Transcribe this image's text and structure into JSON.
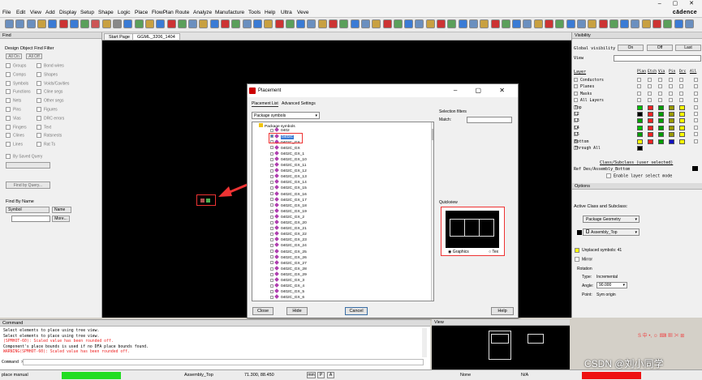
{
  "menu": [
    "File",
    "Edit",
    "View",
    "Add",
    "Display",
    "Setup",
    "Shape",
    "Logic",
    "Place",
    "FlowPlan",
    "Route",
    "Analyze",
    "Manufacture",
    "Tools",
    "Help",
    "Ultra",
    "Veve"
  ],
  "brand": "cādence",
  "find_panel": {
    "title": "Find",
    "filter_title": "Design Object Find Filter",
    "all_on": "All On",
    "all_off": "All Off",
    "col1": [
      "Groups",
      "Comps",
      "Symbols",
      "Functions",
      "Nets",
      "Pins",
      "Vias",
      "Fingers",
      "Clines",
      "Lines"
    ],
    "col2": [
      "Bond wires",
      "Shapes",
      "Voids/Cavities",
      "Cline segs",
      "Other segs",
      "Figures",
      "DRC errors",
      "Text",
      "Ratsnests",
      "Rat Ts"
    ],
    "saved_query": "By Saved Query",
    "find_by_query": "Find by Query...",
    "find_by_name": "Find By Name",
    "name_type": "Symbol",
    "name_field": "Name",
    "more": "More..."
  },
  "canvas": {
    "tabs": [
      "Start Page",
      "GGML_3206_1404"
    ]
  },
  "dialog": {
    "title": "Placement",
    "tabs": [
      "Placement List",
      "Advanced Settings"
    ],
    "dropdown": "Package symbols",
    "root": "Package symbols",
    "items": [
      "0402",
      "0402C",
      "0402C_GX",
      "0402C_GX",
      "0402C_GX_1",
      "0402C_GX_10",
      "0402C_GX_11",
      "0402C_GX_12",
      "0402C_GX_13",
      "0402C_GX_14",
      "0402C_GX_15",
      "0402C_GX_16",
      "0402C_GX_17",
      "0402C_GX_18",
      "0402C_GX_19",
      "0402C_GX_2",
      "0402C_GX_20",
      "0402C_GX_21",
      "0402C_GX_22",
      "0402C_GX_23",
      "0402C_GX_24",
      "0402C_GX_25",
      "0402C_GX_26",
      "0402C_GX_27",
      "0402C_GX_28",
      "0402C_GX_29",
      "0402C_GX_3",
      "0402C_GX_4",
      "0402C_GX_5",
      "0402C_GX_6"
    ],
    "selection_filters": "Selection filters",
    "match_label": "Match:",
    "quickview": "Quickview",
    "radio_graphics": "Graphics",
    "radio_text": "Tex",
    "buttons": [
      "Close",
      "Hide",
      "Cancel",
      "Help"
    ]
  },
  "visibility": {
    "title": "Visibility",
    "global_label": "Global visibility",
    "on": "On",
    "off": "Off",
    "last": "Last",
    "view_label": "View",
    "layer_header": "Layer",
    "col_heads": [
      "Plan",
      "Etch",
      "Via",
      "Pin",
      "Drc",
      "All"
    ],
    "layers": [
      {
        "name": "Conductors",
        "colors": []
      },
      {
        "name": "Planes",
        "colors": []
      },
      {
        "name": "Masks",
        "colors": []
      },
      {
        "name": "All Layers",
        "colors": []
      },
      {
        "name": "Top",
        "colors": [
          "#00c000",
          "#ff2020",
          "#00a000",
          "#9a9a00",
          "#ffff00"
        ]
      },
      {
        "name": "L2",
        "colors": [
          "#000000",
          "#ff2020",
          "#00a000",
          "#9a9a00",
          "#ffff00"
        ]
      },
      {
        "name": "L3",
        "colors": [
          "#00a000",
          "#ff2020",
          "#00a000",
          "#9a9a00",
          "#ffff00"
        ]
      },
      {
        "name": "L4",
        "colors": [
          "#00c000",
          "#ff2020",
          "#00a000",
          "#9a9a00",
          "#ffff00"
        ]
      },
      {
        "name": "L5",
        "colors": [
          "#00a000",
          "#ff2020",
          "#00a000",
          "#9a9a00",
          "#ffff00"
        ]
      },
      {
        "name": "Bottom",
        "colors": [
          "#ffff00",
          "#ff2020",
          "#00a000",
          "#1010c0",
          "#ffff00"
        ]
      },
      {
        "name": "Through All",
        "colors": [
          "#000000",
          "",
          "",
          "",
          ""
        ]
      }
    ],
    "subclass_title": "Class/Subclass (user selected)",
    "subclass_name": "Ref Des/Assembly_Bottom",
    "enable_layer": "Enable layer select mode"
  },
  "options": {
    "title": "Options",
    "active_class": "Active Class and Subclass:",
    "class": "Package Geometry",
    "subclass": "Assembly_Top",
    "unplaced_label": "Unplaced symbols:",
    "unplaced_count": "41",
    "mirror": "Mirror",
    "rotation_label": "Rotation",
    "type_label": "Type:",
    "type_value": "Incremental",
    "angle_label": "Angle:",
    "angle_value": "90.000",
    "point_label": "Point:",
    "point_value": "Sym origin"
  },
  "command": {
    "title": "Command",
    "lines": [
      "Select elements to place using tree view.",
      "Select elements to place using tree view.",
      "(SPMHOT-60): Scaled value has been rounded off.",
      "Component's place bounds is used if no DFA place bounds found.",
      "WARNING(SPMHOT-60): Scaled value has been rounded off."
    ],
    "prompt": "Command >"
  },
  "view_panel": {
    "title": "View"
  },
  "status": {
    "mode": "place manual",
    "subclass": "Assembly_Top",
    "coords": "71.300, 88.450",
    "units": "mm",
    "p": "P",
    "a": "A",
    "none": "None",
    "na": "N/A"
  },
  "watermark": "CSDN @刘小同学"
}
